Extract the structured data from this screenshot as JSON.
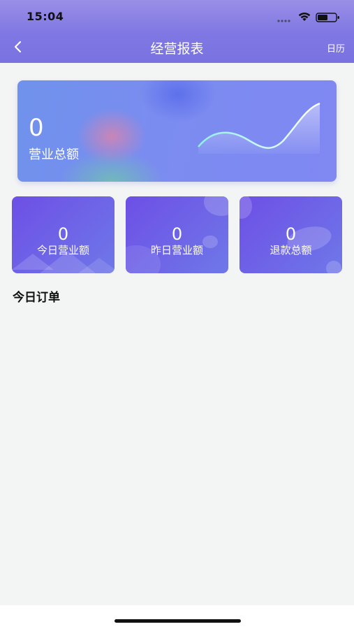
{
  "status_bar": {
    "time": "15:04"
  },
  "nav": {
    "title": "经营报表",
    "calendar_label": "日历"
  },
  "summary": {
    "total_value": "0",
    "total_label": "营业总额"
  },
  "stats": [
    {
      "value": "0",
      "label": "今日营业额"
    },
    {
      "value": "0",
      "label": "昨日营业额"
    },
    {
      "value": "0",
      "label": "退款总额"
    }
  ],
  "section": {
    "title": "今日订单"
  },
  "colors": {
    "header": "#7f77e3",
    "accent": "#6d4fe6",
    "background": "#f3f5f5"
  }
}
